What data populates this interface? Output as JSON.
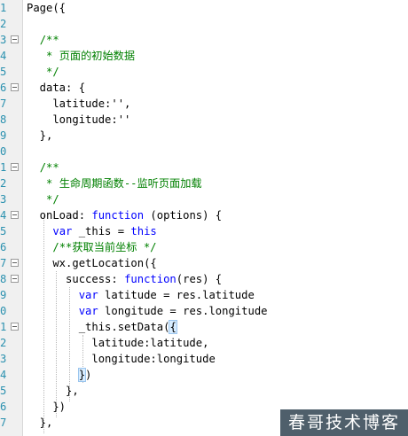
{
  "editor": {
    "lines": [
      {
        "num": "1",
        "code": [
          {
            "t": "tx",
            "v": "Page({"
          }
        ]
      },
      {
        "num": "2",
        "code": []
      },
      {
        "num": "3",
        "code": [
          {
            "t": "tx",
            "v": "  "
          },
          {
            "t": "cm",
            "v": "/**"
          }
        ]
      },
      {
        "num": "4",
        "code": [
          {
            "t": "tx",
            "v": "   "
          },
          {
            "t": "cm",
            "v": "* 页面的初始数据"
          }
        ]
      },
      {
        "num": "5",
        "code": [
          {
            "t": "tx",
            "v": "   "
          },
          {
            "t": "cm",
            "v": "*/"
          }
        ]
      },
      {
        "num": "6",
        "code": [
          {
            "t": "tx",
            "v": "  data: {"
          }
        ]
      },
      {
        "num": "7",
        "code": [
          {
            "t": "tx",
            "v": "    latitude:'',"
          }
        ]
      },
      {
        "num": "8",
        "code": [
          {
            "t": "tx",
            "v": "    longitude:''"
          }
        ]
      },
      {
        "num": "9",
        "code": [
          {
            "t": "tx",
            "v": "  },"
          }
        ]
      },
      {
        "num": "0",
        "code": []
      },
      {
        "num": "1",
        "code": [
          {
            "t": "tx",
            "v": "  "
          },
          {
            "t": "cm",
            "v": "/**"
          }
        ]
      },
      {
        "num": "2",
        "code": [
          {
            "t": "tx",
            "v": "   "
          },
          {
            "t": "cm",
            "v": "* 生命周期函数--监听页面加载"
          }
        ]
      },
      {
        "num": "3",
        "code": [
          {
            "t": "tx",
            "v": "   "
          },
          {
            "t": "cm",
            "v": "*/"
          }
        ]
      },
      {
        "num": "4",
        "code": [
          {
            "t": "tx",
            "v": "  onLoad: "
          },
          {
            "t": "kw",
            "v": "function"
          },
          {
            "t": "tx",
            "v": " (options) {"
          }
        ]
      },
      {
        "num": "5",
        "code": [
          {
            "t": "tx",
            "v": "    "
          },
          {
            "t": "kw",
            "v": "var"
          },
          {
            "t": "tx",
            "v": " _this = "
          },
          {
            "t": "kw",
            "v": "this"
          }
        ]
      },
      {
        "num": "6",
        "code": [
          {
            "t": "tx",
            "v": "    "
          },
          {
            "t": "cm",
            "v": "/**获取当前坐标 */"
          }
        ]
      },
      {
        "num": "7",
        "code": [
          {
            "t": "tx",
            "v": "    wx.getLocation({"
          }
        ]
      },
      {
        "num": "8",
        "code": [
          {
            "t": "tx",
            "v": "      success: "
          },
          {
            "t": "kw",
            "v": "function"
          },
          {
            "t": "tx",
            "v": "(res) {"
          }
        ]
      },
      {
        "num": "9",
        "code": [
          {
            "t": "tx",
            "v": "        "
          },
          {
            "t": "kw",
            "v": "var"
          },
          {
            "t": "tx",
            "v": " latitude = res.latitude"
          }
        ]
      },
      {
        "num": "0",
        "code": [
          {
            "t": "tx",
            "v": "        "
          },
          {
            "t": "kw",
            "v": "var"
          },
          {
            "t": "tx",
            "v": " longitude = res.longitude"
          }
        ]
      },
      {
        "num": "1",
        "code": [
          {
            "t": "tx",
            "v": "        _this.setData("
          },
          {
            "t": "tx",
            "v": "{",
            "hl": true
          }
        ]
      },
      {
        "num": "2",
        "code": [
          {
            "t": "tx",
            "v": "          latitude:latitude,"
          }
        ]
      },
      {
        "num": "3",
        "code": [
          {
            "t": "tx",
            "v": "          longitude:longitude"
          }
        ]
      },
      {
        "num": "4",
        "code": [
          {
            "t": "tx",
            "v": "        "
          },
          {
            "t": "tx",
            "v": "}",
            "hl": true
          },
          {
            "t": "tx",
            "v": ")"
          }
        ]
      },
      {
        "num": "5",
        "code": [
          {
            "t": "tx",
            "v": "      },"
          }
        ]
      },
      {
        "num": "6",
        "code": [
          {
            "t": "tx",
            "v": "    })"
          }
        ]
      },
      {
        "num": "7",
        "code": [
          {
            "t": "tx",
            "v": "  },"
          }
        ]
      }
    ],
    "fold_lines": [
      2,
      5,
      10,
      13,
      16,
      17,
      20
    ]
  },
  "watermark": {
    "label": "春哥技术博客"
  },
  "colors": {
    "keyword": "#0000ff",
    "comment": "#008000",
    "line_number": "#2b91af",
    "gutter": "#f0f0f0"
  }
}
